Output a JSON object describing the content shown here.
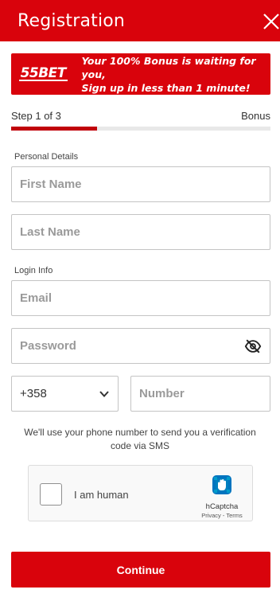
{
  "header": {
    "title": "Registration",
    "close_icon": "close-icon"
  },
  "banner": {
    "logo_text": "55BET",
    "promo_line1": "Your 100% Bonus is waiting for you,",
    "promo_line2": "Sign up in less than 1 minute!"
  },
  "steps": {
    "current": "Step 1 of 3",
    "next": "Bonus",
    "progress_fraction": 0.33
  },
  "personal": {
    "label": "Personal Details",
    "first_name_placeholder": "First Name",
    "last_name_placeholder": "Last Name"
  },
  "login": {
    "label": "Login Info",
    "email_placeholder": "Email",
    "password_placeholder": "Password",
    "password_toggle_icon": "eye-slash-icon"
  },
  "phone": {
    "country_code": "+358",
    "number_placeholder": "Number",
    "note": "We'll use your phone number to send you a verification code via SMS"
  },
  "captcha": {
    "label": "I am human",
    "brand": "hCaptcha",
    "links": "Privacy - Terms"
  },
  "actions": {
    "continue_label": "Continue"
  },
  "colors": {
    "brand_red": "#d9030c",
    "progress_red": "#c1020b",
    "border": "#c4c4c4"
  }
}
